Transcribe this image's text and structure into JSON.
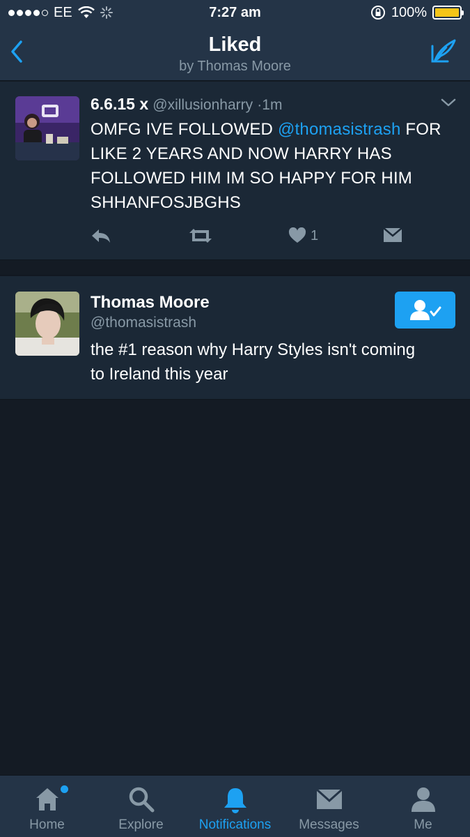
{
  "status_bar": {
    "carrier": "EE",
    "time": "7:27 am",
    "battery": "100%",
    "battery_level": 1.0
  },
  "header": {
    "title": "Liked",
    "subtitle": "by Thomas Moore"
  },
  "tweet": {
    "name": "6.6.15 x",
    "handle": "@xillusionharry",
    "time_sep": "·",
    "time": "1m",
    "text_before": "OMFG IVE FOLLOWED ",
    "mention": "@thomasistrash",
    "text_after": " FOR LIKE 2 YEARS AND NOW HARRY HAS FOLLOWED HIM IM SO HAPPY FOR HIM SHHANFOSJBGHS",
    "like_count": "1"
  },
  "user": {
    "name": "Thomas Moore",
    "handle": "@thomasistrash",
    "bio": "the #1 reason why Harry Styles isn't coming to Ireland this year"
  },
  "tabs": [
    {
      "label": "Home",
      "icon": "home-icon"
    },
    {
      "label": "Explore",
      "icon": "search-icon"
    },
    {
      "label": "Notifications",
      "icon": "bell-icon"
    },
    {
      "label": "Messages",
      "icon": "envelope-icon"
    },
    {
      "label": "Me",
      "icon": "person-icon"
    }
  ],
  "colors": {
    "accent": "#1da1f2",
    "background": "#141b24",
    "card": "#1b2836",
    "bar": "#243447",
    "secondary_text": "#8899a6"
  }
}
